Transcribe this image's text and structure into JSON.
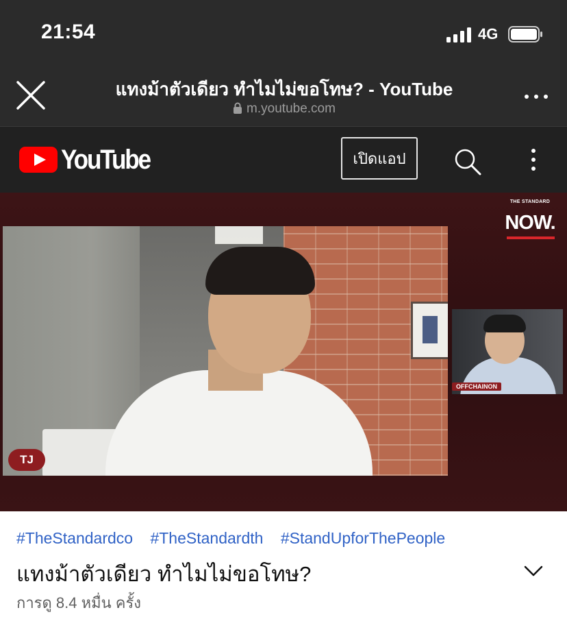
{
  "status_bar": {
    "time": "21:54",
    "network": "4G",
    "icons": [
      "signal-bars-icon",
      "battery-icon"
    ]
  },
  "browser": {
    "page_title": "แทงม้าตัวเดียว ทำไมไม่ขอโทษ? - YouTube",
    "domain": "m.youtube.com",
    "icons": [
      "close-icon",
      "lock-icon",
      "more-horizontal-icon"
    ]
  },
  "youtube_header": {
    "logo_text": "YouTube",
    "open_app_label": "เปิดแอป",
    "icons": [
      "youtube-play-icon",
      "search-icon",
      "more-vertical-icon"
    ],
    "colors": {
      "brand_red": "#ff0000",
      "header_bg": "#212121"
    }
  },
  "video": {
    "overlay_brand_small": "THE STANDARD",
    "overlay_brand": "NOW.",
    "host_tag": "TJ",
    "guest_tag": "OFFCHAINON"
  },
  "info": {
    "hashtags": [
      "#TheStandardco",
      "#TheStandardth",
      "#StandUpforThePeople"
    ],
    "title": "แทงม้าตัวเดียว ทำไมไม่ขอโทษ?",
    "views": "การดู 8.4 หมื่น ครั้ง",
    "colors": {
      "hashtag": "#3062c6"
    },
    "icons": [
      "chevron-down-icon"
    ]
  }
}
